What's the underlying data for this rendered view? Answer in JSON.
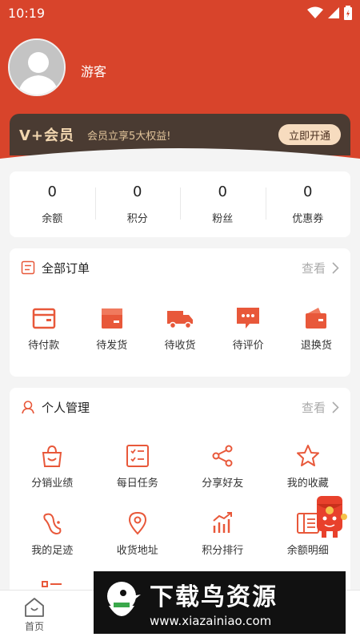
{
  "status": {
    "time": "10:19"
  },
  "profile": {
    "username": "游客"
  },
  "vip": {
    "logo": "V+会员",
    "text": "会员立享5大权益!",
    "button": "立即开通"
  },
  "stats": [
    {
      "value": "0",
      "label": "余额"
    },
    {
      "value": "0",
      "label": "积分"
    },
    {
      "value": "0",
      "label": "粉丝"
    },
    {
      "value": "0",
      "label": "优惠券"
    }
  ],
  "orders": {
    "title": "全部订单",
    "more": "查看",
    "items": [
      {
        "label": "待付款",
        "icon": "wallet-icon"
      },
      {
        "label": "待发货",
        "icon": "box-icon"
      },
      {
        "label": "待收货",
        "icon": "truck-icon"
      },
      {
        "label": "待评价",
        "icon": "comment-icon"
      },
      {
        "label": "退换货",
        "icon": "refund-icon"
      }
    ]
  },
  "personal": {
    "title": "个人管理",
    "more": "查看",
    "items": [
      {
        "label": "分销业绩",
        "icon": "bag-icon"
      },
      {
        "label": "每日任务",
        "icon": "checklist-icon"
      },
      {
        "label": "分享好友",
        "icon": "share-icon"
      },
      {
        "label": "我的收藏",
        "icon": "star-icon"
      },
      {
        "label": "我的足迹",
        "icon": "footprint-icon"
      },
      {
        "label": "收货地址",
        "icon": "location-icon"
      },
      {
        "label": "积分排行",
        "icon": "ranking-icon"
      },
      {
        "label": "余额明细",
        "icon": "bill-icon"
      }
    ]
  },
  "nav": {
    "home": "首页"
  },
  "watermark": {
    "title": "下载鸟资源",
    "url": "www.xiazainiao.com"
  },
  "colors": {
    "primary": "#d8442b",
    "icon": "#e8583a",
    "vip_bg": "#4a3b32",
    "vip_btn": "#f7dcbf"
  }
}
